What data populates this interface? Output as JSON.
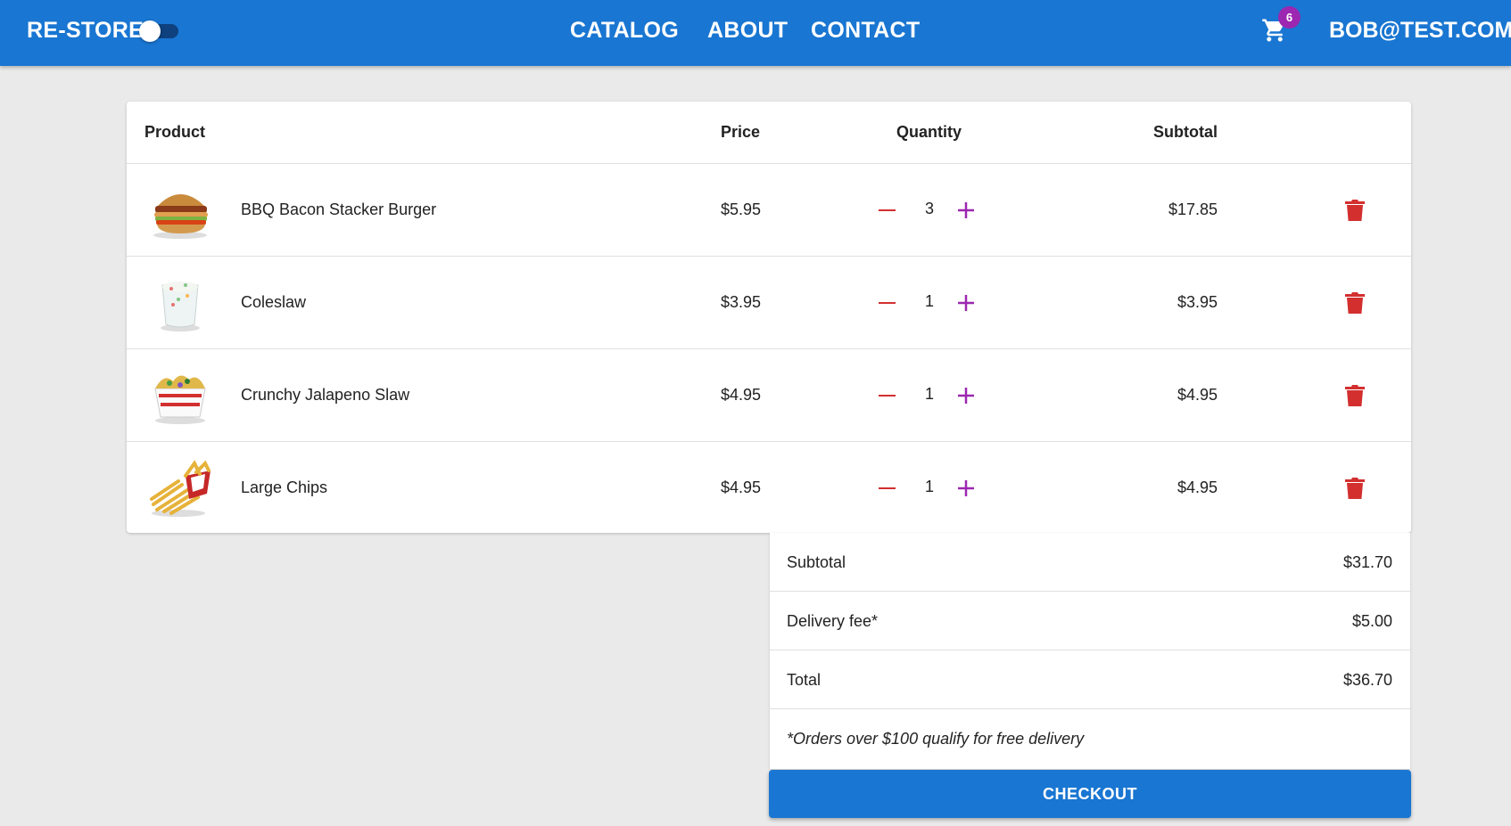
{
  "header": {
    "brand": "RE-STORE",
    "dark_mode_toggle": "off",
    "nav": [
      "CATALOG",
      "ABOUT",
      "CONTACT"
    ],
    "cart_badge": "6",
    "user": "BOB@TEST.COM"
  },
  "table": {
    "columns": [
      "Product",
      "Price",
      "Quantity",
      "Subtotal"
    ],
    "rows": [
      {
        "name": "BBQ Bacon Stacker Burger",
        "price": "$5.95",
        "qty": "3",
        "subtotal": "$17.85",
        "image": "burger"
      },
      {
        "name": "Coleslaw",
        "price": "$3.95",
        "qty": "1",
        "subtotal": "$3.95",
        "image": "coleslaw"
      },
      {
        "name": "Crunchy Jalapeno Slaw",
        "price": "$4.95",
        "qty": "1",
        "subtotal": "$4.95",
        "image": "jalapeno-slaw"
      },
      {
        "name": "Large Chips",
        "price": "$4.95",
        "qty": "1",
        "subtotal": "$4.95",
        "image": "chips"
      }
    ]
  },
  "summary": {
    "subtotal_label": "Subtotal",
    "subtotal_value": "$31.70",
    "delivery_label": "Delivery fee*",
    "delivery_value": "$5.00",
    "total_label": "Total",
    "total_value": "$36.70",
    "note": "*Orders over $100 qualify for free delivery"
  },
  "checkout_label": "CHECKOUT",
  "colors": {
    "primary": "#1976d2",
    "badge": "#9c27b0",
    "minus": "#d32f2f",
    "plus": "#9c27b0",
    "delete": "#d32f2f"
  }
}
